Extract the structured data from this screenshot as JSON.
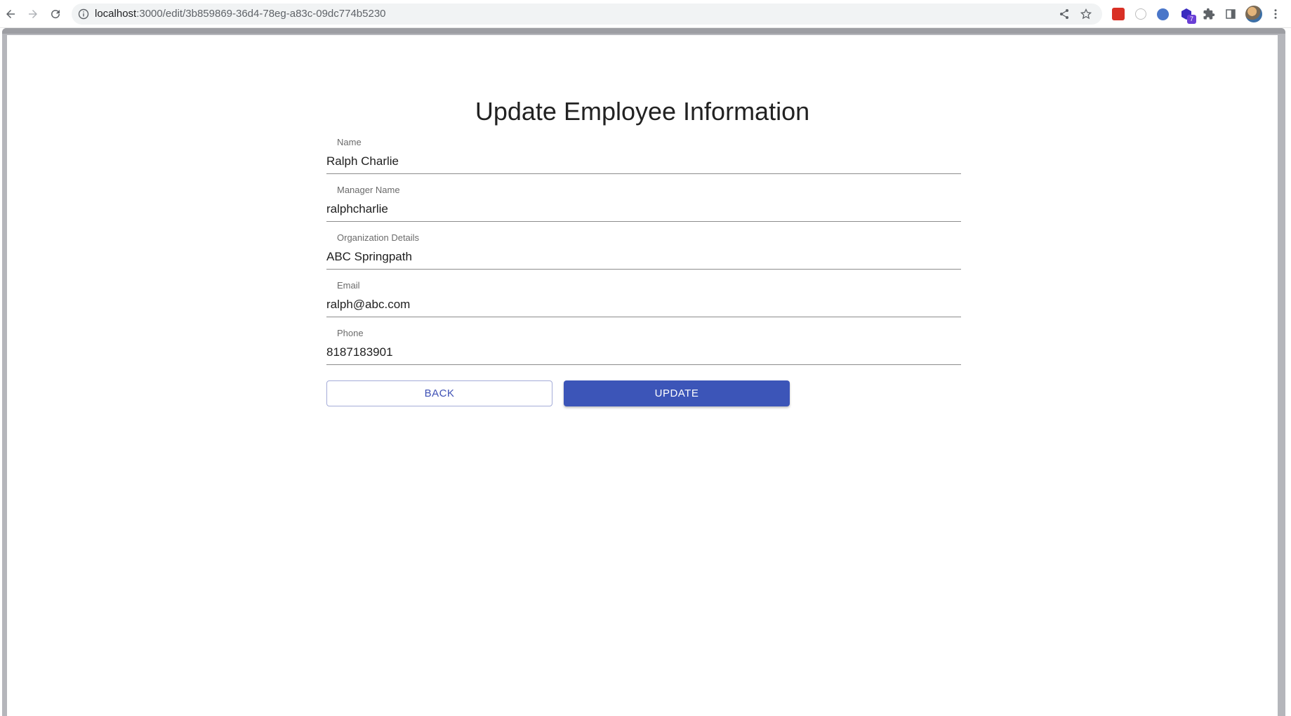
{
  "browser": {
    "url_host": "localhost",
    "url_path": ":3000/edit/3b859869-36d4-78eg-a83c-09dc774b5230",
    "extension_badge": "7"
  },
  "form": {
    "title": "Update Employee Information",
    "fields": [
      {
        "label": "Name",
        "value": "Ralph Charlie"
      },
      {
        "label": "Manager Name",
        "value": "ralphcharlie"
      },
      {
        "label": "Organization Details",
        "value": "ABC Springpath"
      },
      {
        "label": "Email",
        "value": "ralph@abc.com"
      },
      {
        "label": "Phone",
        "value": "8187183901"
      }
    ],
    "back_label": "BACK",
    "update_label": "UPDATE"
  },
  "colors": {
    "primary": "#3c55b8",
    "outline": "#a4acd8",
    "frame": "#b5b6bb"
  }
}
